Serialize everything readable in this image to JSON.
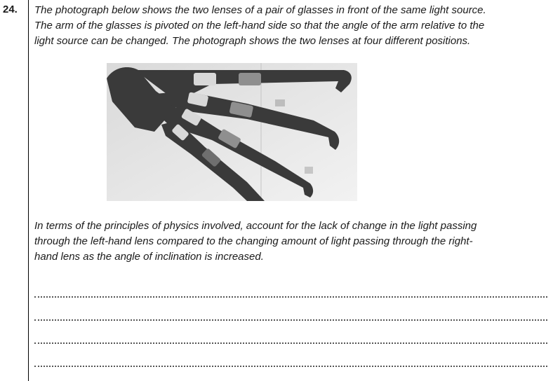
{
  "question": {
    "number": "24.",
    "intro_lines": [
      "The photograph below shows the two lenses of a pair of glasses in front of the same light source.",
      "The arm of the glasses is pivoted on the left-hand side so that the angle of the arm relative to the",
      "light source can be changed. The photograph shows the two lenses at four different positions."
    ],
    "prompt_lines": [
      "In terms of the principles of physics involved, account for the lack of change in the light passing",
      "through the left-hand lens compared to the changing amount of light passing through the right-",
      "hand lens as the angle of inclination is increased."
    ]
  },
  "colors": {
    "frame": "#3a3a3a",
    "background_light": "#e9e9e9",
    "lens_left": "#d8d8d8",
    "lens_right": "#8f8f8f"
  }
}
